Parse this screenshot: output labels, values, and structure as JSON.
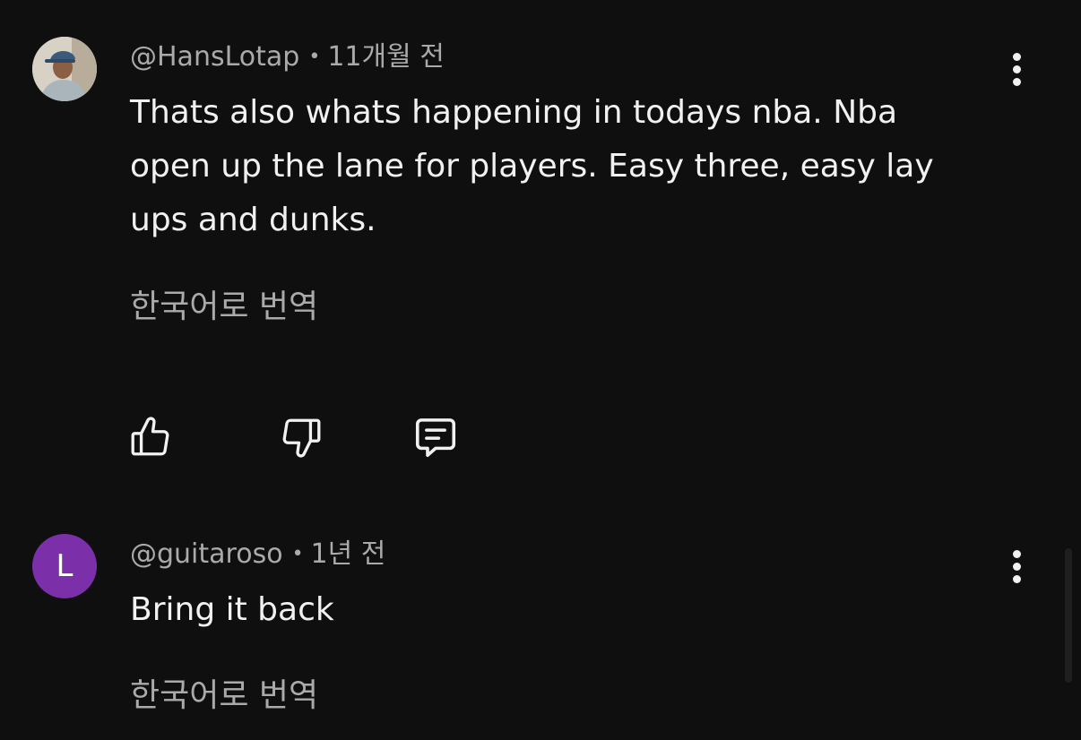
{
  "comments": [
    {
      "author": "@HansLotap",
      "time": "11개월 전",
      "separator": "•",
      "text": "Thats also whats happening in todays nba. Nba open up the lane for players. Easy three, easy lay ups and dunks.",
      "translate_label": "한국어로 번역",
      "avatar_icon": "profile-photo"
    },
    {
      "author": "@guitaroso",
      "time": "1년 전",
      "separator": "•",
      "avatar_letter": "L",
      "avatar_color": "#7b2fa8",
      "text": "Bring it back",
      "translate_label": "한국어로 번역"
    }
  ],
  "actions": {
    "like_icon": "thumbs-up-icon",
    "dislike_icon": "thumbs-down-icon",
    "reply_icon": "reply-comment-icon",
    "more_icon": "more-vertical-icon"
  }
}
